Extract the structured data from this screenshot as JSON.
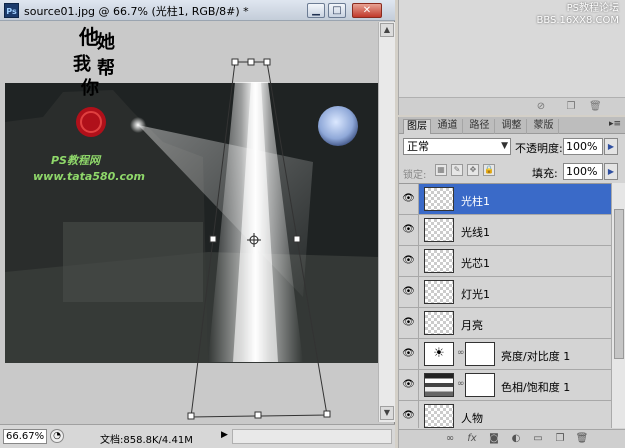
{
  "document": {
    "title": "source01.jpg @ 66.7% (光柱1, RGB/8#) *",
    "app_icon_label": "Ps",
    "status_zoom": "66.67%",
    "status_doc_info": "文档:858.8K/4.41M"
  },
  "canvas_overlay": {
    "calligraphy_lines": [
      "他",
      "她",
      "我",
      "帮",
      "你"
    ],
    "site_label": "PS教程网",
    "site_url": "www.tata580.com"
  },
  "watermark": {
    "line1": "PS教程论坛",
    "line2": "BBS.16XX8.COM"
  },
  "layers_panel": {
    "tabs": [
      "图层",
      "通道",
      "路径",
      "调整",
      "蒙版"
    ],
    "active_tab": 0,
    "blend_mode": "正常",
    "opacity_label": "不透明度:",
    "opacity_value": "100%",
    "lock_label": "锁定:",
    "fill_label": "填充:",
    "fill_value": "100%",
    "layers": [
      {
        "name": "光柱1",
        "selected": true,
        "type": "pixel"
      },
      {
        "name": "光线1",
        "selected": false,
        "type": "pixel"
      },
      {
        "name": "光芯1",
        "selected": false,
        "type": "pixel"
      },
      {
        "name": "灯光1",
        "selected": false,
        "type": "pixel"
      },
      {
        "name": "月亮",
        "selected": false,
        "type": "pixel"
      },
      {
        "name": "亮度/对比度 1",
        "selected": false,
        "type": "adjustment-brightness"
      },
      {
        "name": "色相/饱和度 1",
        "selected": false,
        "type": "adjustment-hue"
      },
      {
        "name": "人物",
        "selected": false,
        "type": "pixel"
      }
    ]
  },
  "colors": {
    "selected_layer": "#3a6ac8",
    "panel_bg": "#d4d4d4",
    "stamp_red": "#b0101a"
  }
}
